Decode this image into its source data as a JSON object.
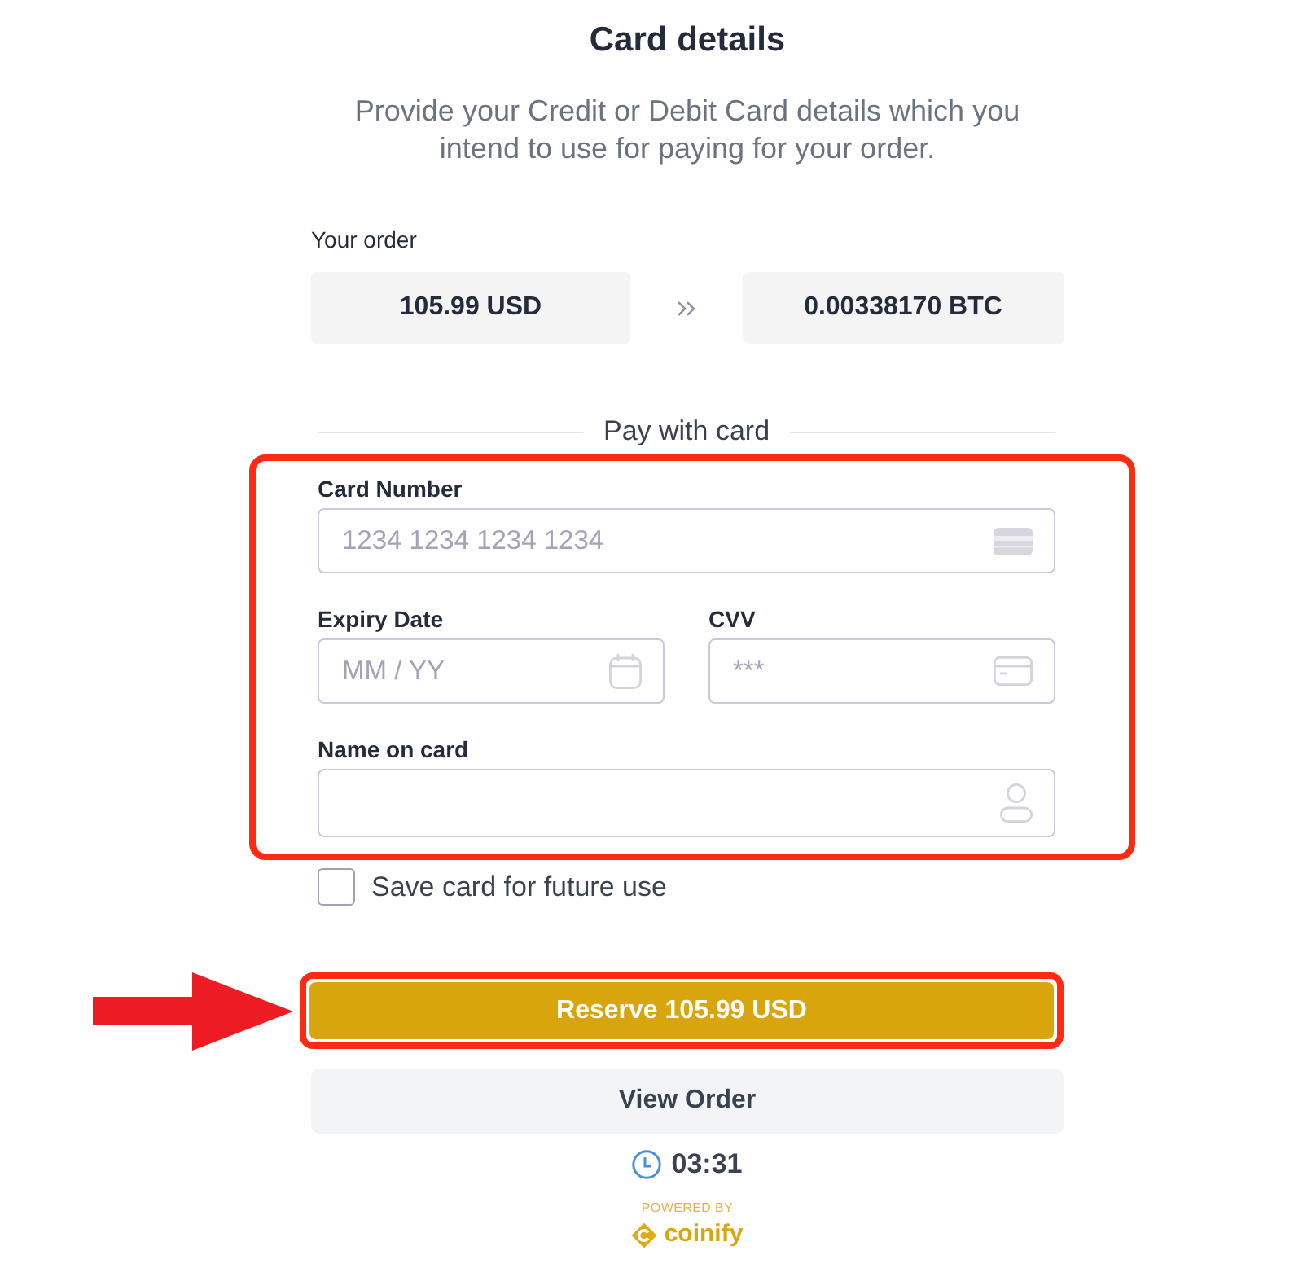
{
  "header": {
    "title": "Card details",
    "subtitle": "Provide your Credit or Debit Card details which you intend to use for paying for your order."
  },
  "order": {
    "label": "Your order",
    "fiat_amount": "105.99 USD",
    "crypto_amount": "0.00338170 BTC"
  },
  "divider_label": "Pay with card",
  "fields": [
    {
      "kind": "card_number",
      "label": "Card Number",
      "placeholder": "1234 1234 1234 1234"
    },
    {
      "kind": "expiry",
      "label": "Expiry Date",
      "placeholder": "MM / YY"
    },
    {
      "kind": "cvv",
      "label": "CVV",
      "placeholder": "***"
    },
    {
      "kind": "name",
      "label": "Name on card"
    }
  ],
  "save_card": {
    "label": "Save card for future use",
    "checked": false
  },
  "actions": {
    "primary": "Reserve 105.99 USD",
    "secondary": "View Order"
  },
  "timer": "03:31",
  "footer": {
    "powered_by": "POWERED BY",
    "brand": "coinify"
  }
}
